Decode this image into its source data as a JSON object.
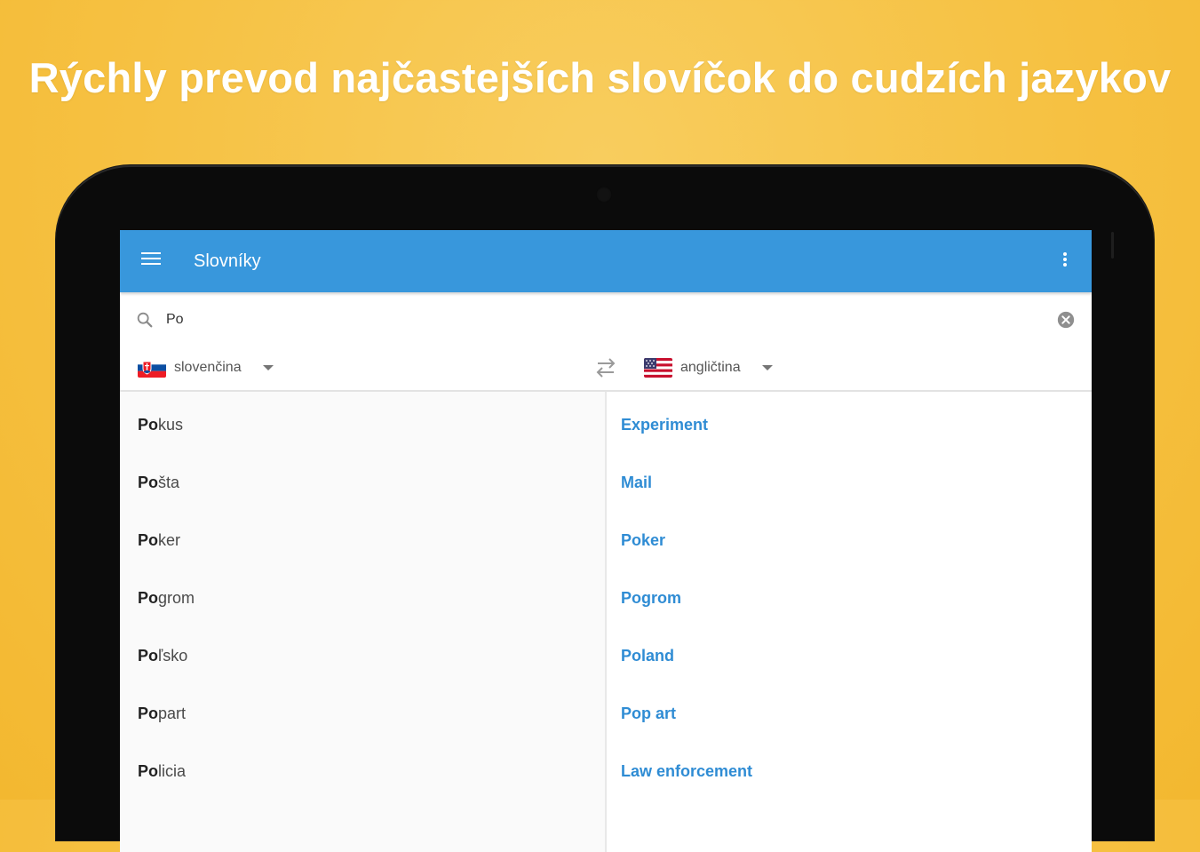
{
  "headline": "Rýchly prevod najčastejších slovíčok do cudzích jazykov",
  "app": {
    "title": "Slovníky",
    "menu_icon": "hamburger-menu-icon",
    "overflow_icon": "more-vert-icon",
    "accent_color": "#3897dc"
  },
  "search": {
    "query": "Po",
    "placeholder": "",
    "icon": "search-icon",
    "clear_icon": "clear-circle-icon"
  },
  "languages": {
    "from": {
      "label": "slovenčina",
      "flag": "slovakia-flag"
    },
    "to": {
      "label": "angličtina",
      "flag": "usa-flag"
    },
    "swap_icon": "swap-arrows-icon"
  },
  "results": [
    {
      "match": "Po",
      "rest": "kus",
      "translation": "Experiment"
    },
    {
      "match": "Po",
      "rest": "šta",
      "translation": "Mail"
    },
    {
      "match": "Po",
      "rest": "ker",
      "translation": "Poker"
    },
    {
      "match": "Po",
      "rest": "grom",
      "translation": "Pogrom"
    },
    {
      "match": "Po",
      "rest": "ľsko",
      "translation": "Poland"
    },
    {
      "match": "Po",
      "rest": "part",
      "translation": "Pop art"
    },
    {
      "match": "Po",
      "rest": "licia",
      "translation": "Law enforcement"
    }
  ]
}
